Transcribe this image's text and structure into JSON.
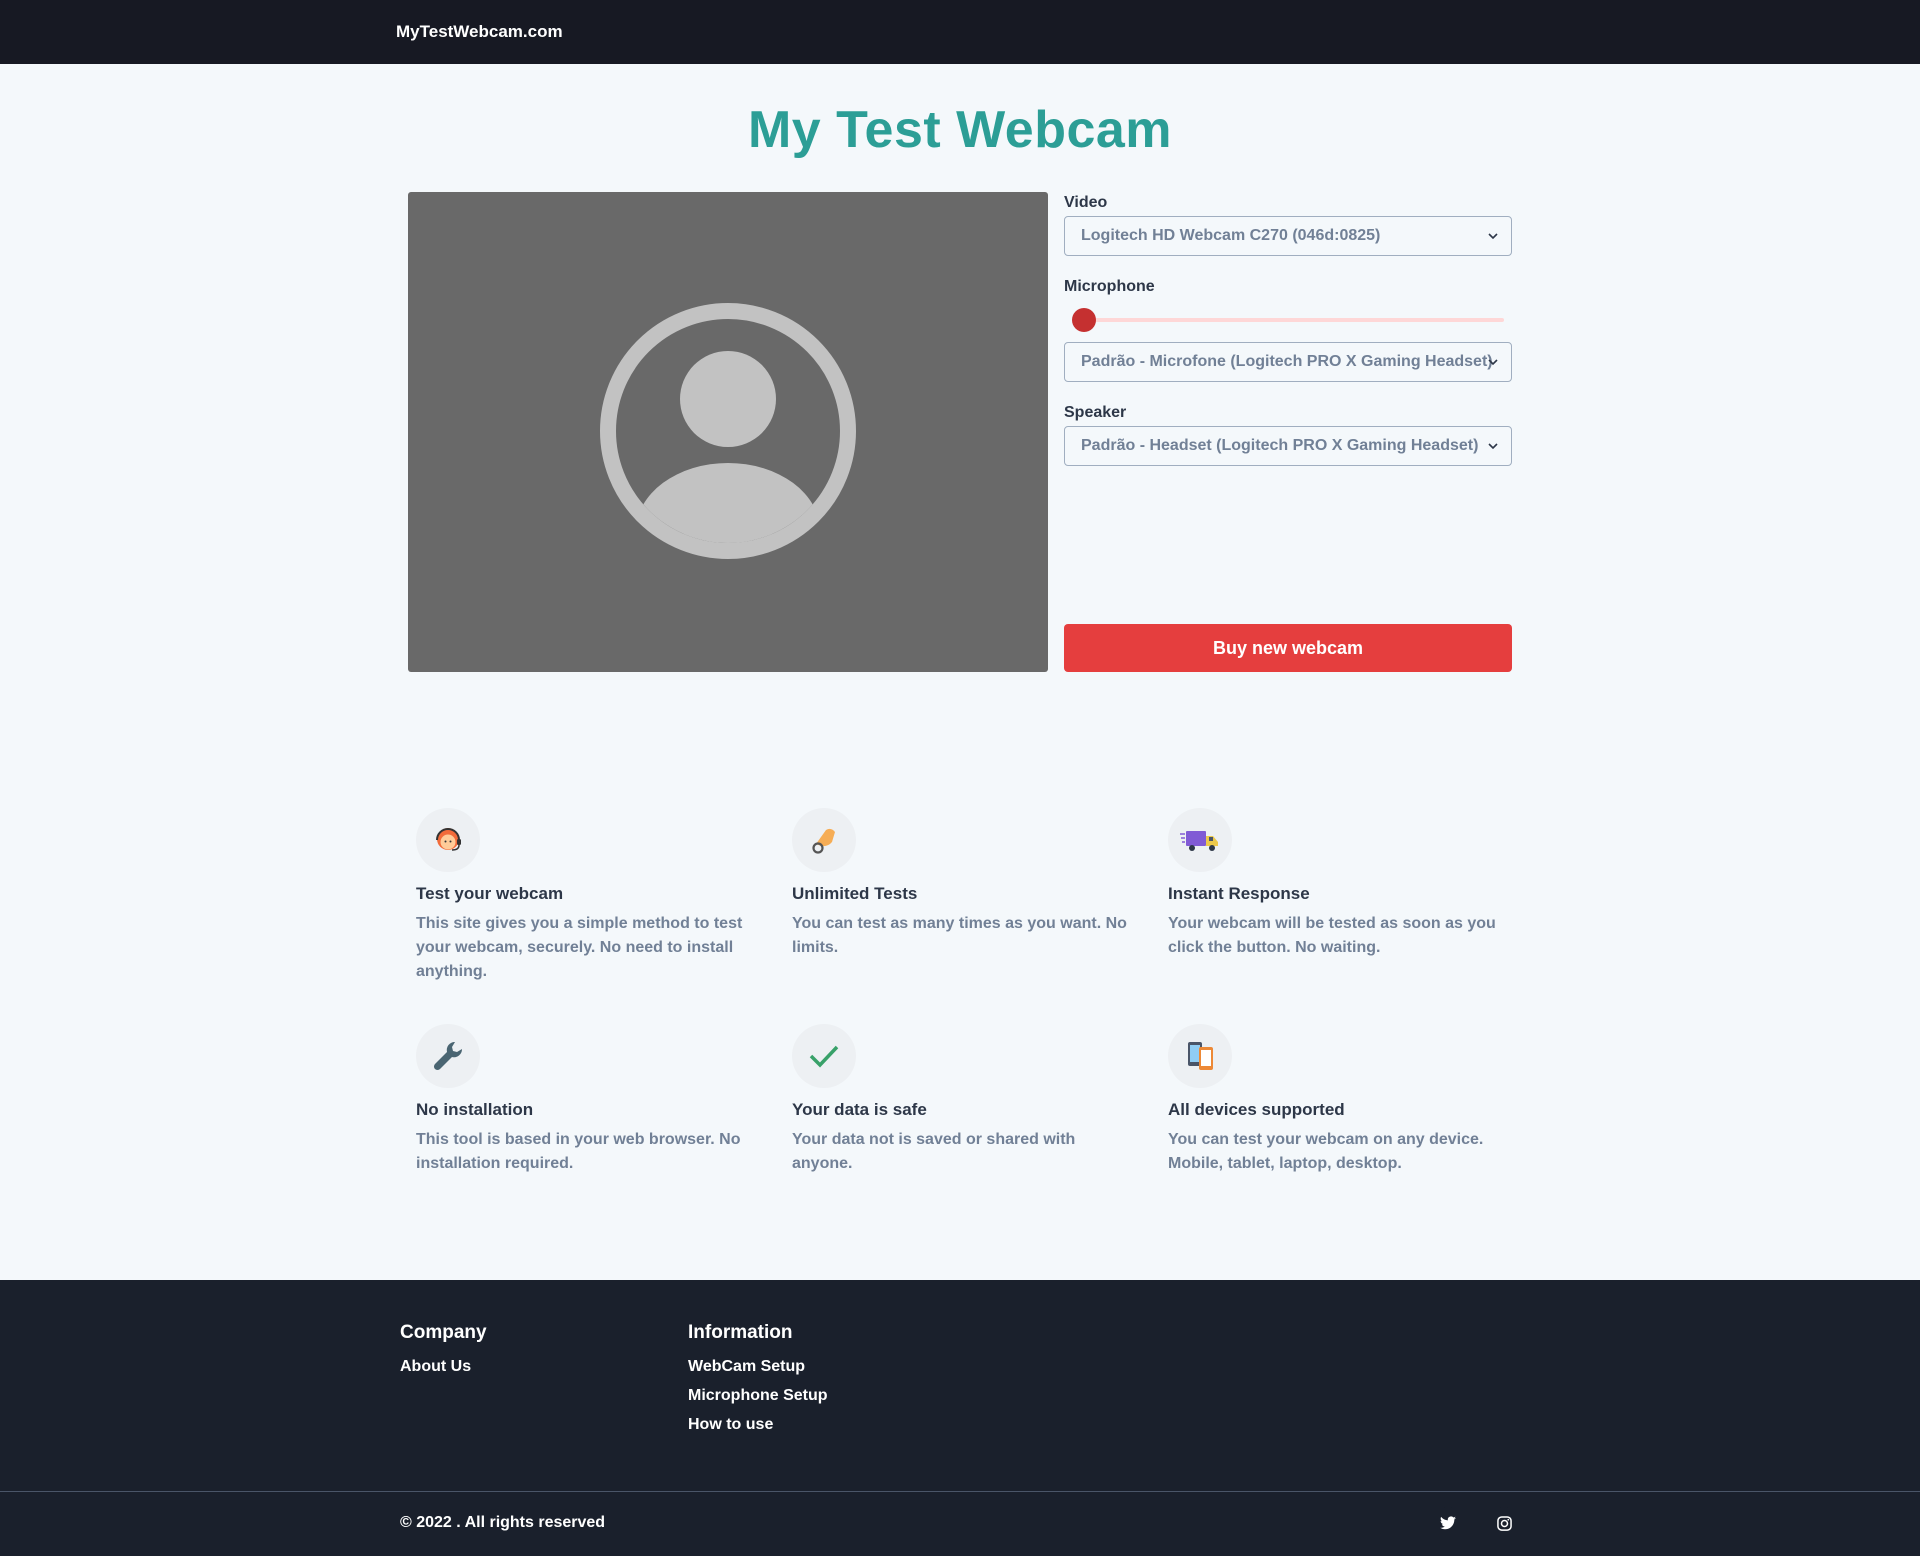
{
  "header": {
    "brand": "MyTestWebcam.com"
  },
  "page_title": "My Test Webcam",
  "controls": {
    "video": {
      "label": "Video",
      "selected": "Logitech HD Webcam C270 (046d:0825)"
    },
    "microphone": {
      "label": "Microphone",
      "level": 0.0,
      "selected": "Padrão - Microfone (Logitech PRO X Gaming Headset)"
    },
    "speaker": {
      "label": "Speaker",
      "selected": "Padrão - Headset (Logitech PRO X Gaming Headset)"
    },
    "buy_button": "Buy new webcam"
  },
  "features": [
    {
      "icon": "support-agent-icon",
      "title": "Test your webcam",
      "text": "This site gives you a simple method to test your webcam, securely. No need to install anything."
    },
    {
      "icon": "hand-icon",
      "title": "Unlimited Tests",
      "text": "You can test as many times as you want. No limits."
    },
    {
      "icon": "delivery-truck-icon",
      "title": "Instant Response",
      "text": "Your webcam will be tested as soon as you click the button. No waiting."
    },
    {
      "icon": "wrench-icon",
      "title": "No installation",
      "text": "This tool is based in your web browser. No installation required."
    },
    {
      "icon": "checkmark-icon",
      "title": "Your data is safe",
      "text": "Your data not is saved or shared with anyone."
    },
    {
      "icon": "devices-icon",
      "title": "All devices supported",
      "text": "You can test your webcam on any device. Mobile, tablet, laptop, desktop."
    }
  ],
  "footer": {
    "company": {
      "heading": "Company",
      "links": [
        "About Us"
      ]
    },
    "information": {
      "heading": "Information",
      "links": [
        "WebCam Setup",
        "Microphone Setup",
        "How to use"
      ]
    },
    "copyright": "© 2022 . All rights reserved",
    "social": [
      "twitter-icon",
      "instagram-icon"
    ]
  },
  "colors": {
    "accent": "#2c9e96",
    "button": "#e53e3e",
    "dark": "#171923",
    "slider_thumb": "#c53030"
  }
}
